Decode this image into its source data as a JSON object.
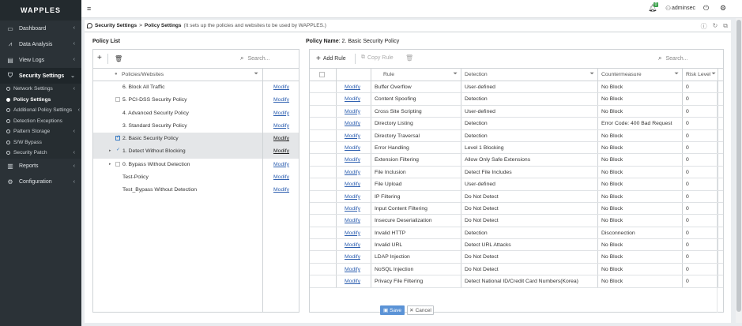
{
  "app": {
    "logo": "WAPPLES"
  },
  "sidebar": {
    "items": [
      {
        "label": "Dashboard",
        "icon": "monitor-icon"
      },
      {
        "label": "Data Analysis",
        "icon": "chart-icon"
      },
      {
        "label": "View Logs",
        "icon": "document-icon"
      },
      {
        "label": "Security Settings",
        "icon": "shield-icon"
      },
      {
        "label": "Reports",
        "icon": "bar-chart-icon"
      },
      {
        "label": "Configuration",
        "icon": "gear-icon"
      }
    ],
    "sub_items": [
      {
        "label": "Network Settings"
      },
      {
        "label": "Policy Settings"
      },
      {
        "label": "Additional Policy Settings"
      },
      {
        "label": "Detection Exceptions"
      },
      {
        "label": "Pattern Storage"
      },
      {
        "label": "S/W Bypass"
      },
      {
        "label": "Security Patch"
      }
    ]
  },
  "topbar": {
    "user": "adminsec",
    "notification_count": "0"
  },
  "breadcrumb": {
    "parent": "Security Settings",
    "sep": ">",
    "current": "Policy Settings",
    "description": "(It sets up the policies and websites to be used by WAPPLES.)"
  },
  "policy_list": {
    "title": "Policy List",
    "search_placeholder": "Search...",
    "column": "Policies/Websites",
    "rows": [
      {
        "label": "6. Block All Traffic",
        "action": "Modify"
      },
      {
        "label": "5. PCI-DSS Security Policy",
        "action": "Modify"
      },
      {
        "label": "4. Advanced Security Policy",
        "action": "Modify"
      },
      {
        "label": "3. Standard Security Policy",
        "action": "Modify"
      },
      {
        "label": "2. Basic Security Policy",
        "action": "Modify"
      },
      {
        "label": "1. Detect Without Blocking",
        "action": "Modify"
      },
      {
        "label": "0. Bypass Without Detection",
        "action": "Modify"
      },
      {
        "label": "Test-Policy",
        "action": "Modify"
      },
      {
        "label": "Test_Bypass Without Detection",
        "action": "Modify"
      }
    ]
  },
  "policy_detail": {
    "name_label": "Policy Name",
    "name_value": ": 2. Basic Security Policy",
    "add_rule": "Add Rule",
    "copy_rule": "Copy Rule",
    "search_placeholder": "Search...",
    "columns": {
      "rule": "Rule",
      "detection": "Detection",
      "countermeasure": "Countermeasure",
      "risk": "Risk Level"
    },
    "rows": [
      {
        "action": "Modify",
        "rule": "Buffer Overflow",
        "detection": "User-defined",
        "countermeasure": "No Block",
        "risk": "0"
      },
      {
        "action": "Modify",
        "rule": "Content Spoofing",
        "detection": "Detection",
        "countermeasure": "No Block",
        "risk": "0"
      },
      {
        "action": "Modify",
        "rule": "Cross Site Scripting",
        "detection": "User-defined",
        "countermeasure": "No Block",
        "risk": "0"
      },
      {
        "action": "Modify",
        "rule": "Directory Listing",
        "detection": "Detection",
        "countermeasure": "Error Code: 400 Bad Request",
        "risk": "0"
      },
      {
        "action": "Modify",
        "rule": "Directory Traversal",
        "detection": "Detection",
        "countermeasure": "No Block",
        "risk": "0"
      },
      {
        "action": "Modify",
        "rule": "Error Handling",
        "detection": "Level 1 Blocking",
        "countermeasure": "No Block",
        "risk": "0"
      },
      {
        "action": "Modify",
        "rule": "Extension Filtering",
        "detection": "Allow Only Safe Extensions",
        "countermeasure": "No Block",
        "risk": "0"
      },
      {
        "action": "Modify",
        "rule": "File Inclusion",
        "detection": "Detect File Includes",
        "countermeasure": "No Block",
        "risk": "0"
      },
      {
        "action": "Modify",
        "rule": "File Upload",
        "detection": "User-defined",
        "countermeasure": "No Block",
        "risk": "0"
      },
      {
        "action": "Modify",
        "rule": "IP Filtering",
        "detection": "Do Not Detect",
        "countermeasure": "No Block",
        "risk": "0"
      },
      {
        "action": "Modify",
        "rule": "Input Content Filtering",
        "detection": "Do Not Detect",
        "countermeasure": "No Block",
        "risk": "0"
      },
      {
        "action": "Modify",
        "rule": "Insecure Deserialization",
        "detection": "Do Not Detect",
        "countermeasure": "No Block",
        "risk": "0"
      },
      {
        "action": "Modify",
        "rule": "Invalid HTTP",
        "detection": "Detection",
        "countermeasure": "Disconnection",
        "risk": "0"
      },
      {
        "action": "Modify",
        "rule": "Invalid URL",
        "detection": "Detect URL Attacks",
        "countermeasure": "No Block",
        "risk": "0"
      },
      {
        "action": "Modify",
        "rule": "LDAP Injection",
        "detection": "Do Not Detect",
        "countermeasure": "No Block",
        "risk": "0"
      },
      {
        "action": "Modify",
        "rule": "NoSQL Injection",
        "detection": "Do Not Detect",
        "countermeasure": "No Block",
        "risk": "0"
      },
      {
        "action": "Modify",
        "rule": "Privacy File Filtering",
        "detection": "Detect National ID/Credit Card Numbers(Korea)",
        "countermeasure": "No Block",
        "risk": "0"
      }
    ]
  },
  "footer": {
    "save": "Save",
    "cancel": "Cancel"
  },
  "colors": {
    "sidebar_bg": "#2b3237",
    "link": "#2d5fb0",
    "save_btn": "#5b93d6",
    "selected_row": "#e4e6e8"
  }
}
